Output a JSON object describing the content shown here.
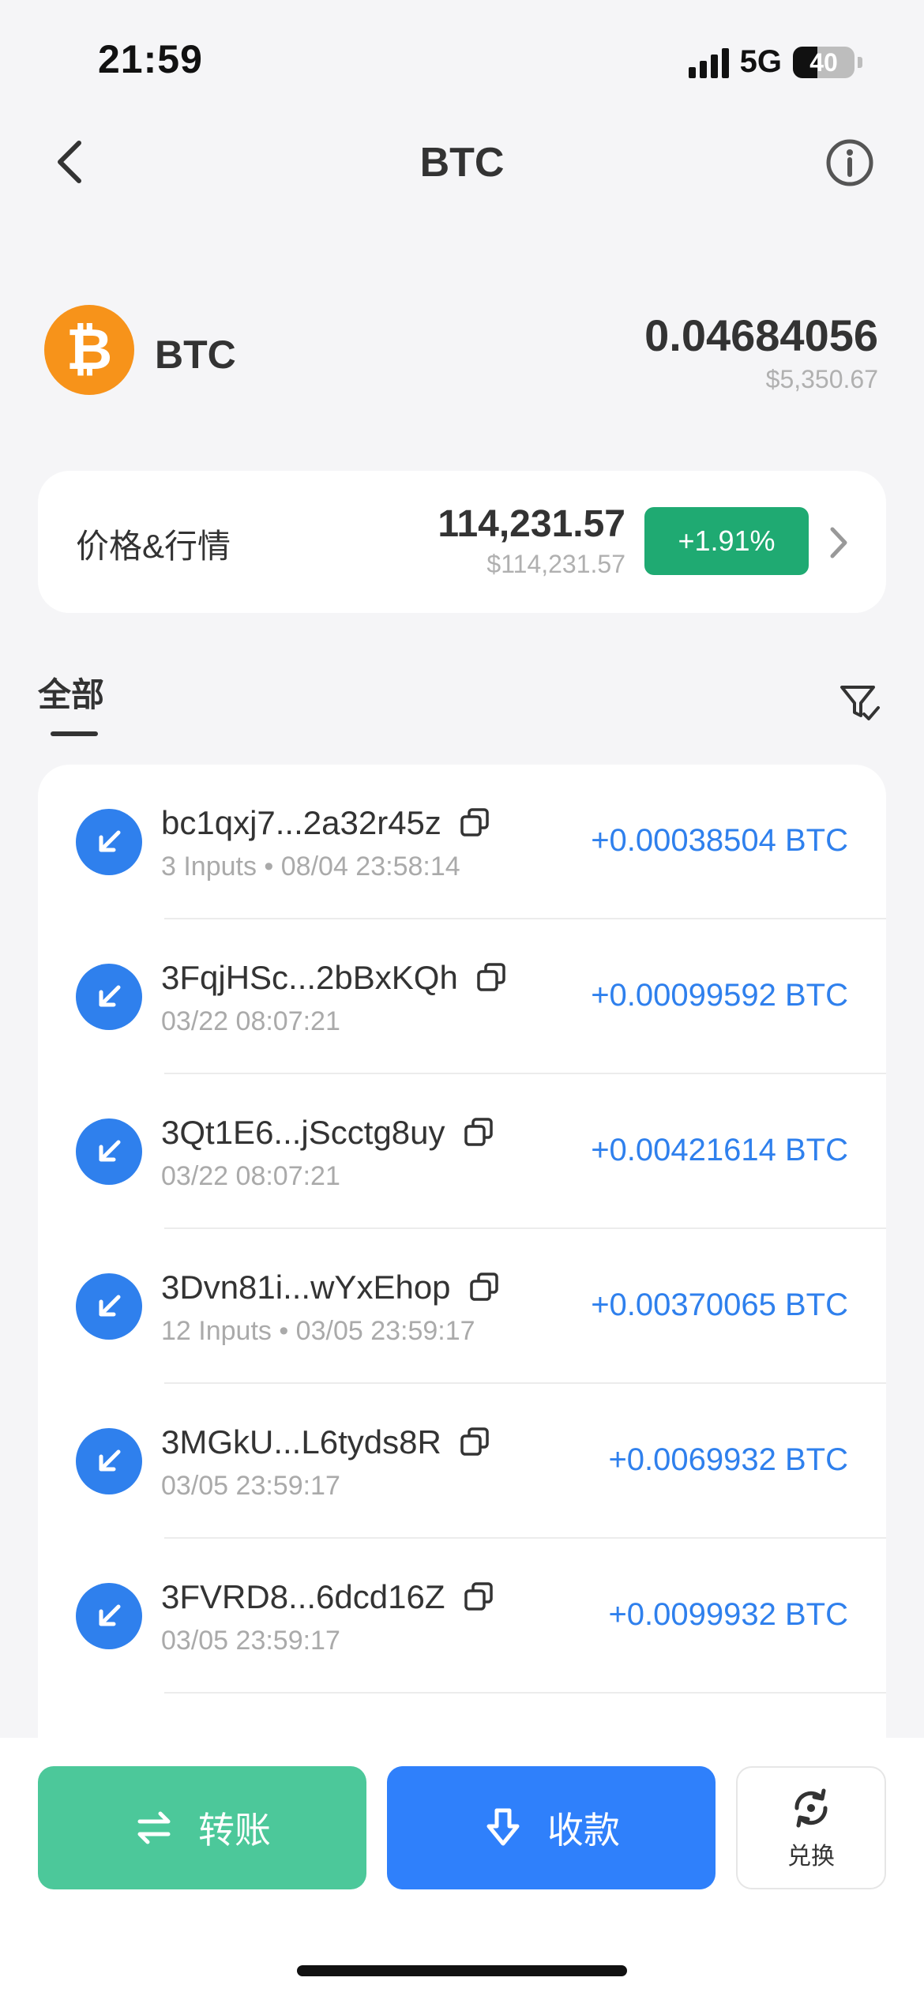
{
  "status_bar": {
    "time": "21:59",
    "network": "5G",
    "battery": "40",
    "battery_level": 0.4
  },
  "nav": {
    "title": "BTC",
    "back_icon": "chevron-left-icon",
    "info_icon": "info-icon"
  },
  "asset": {
    "symbol": "BTC",
    "logo_glyph": "₿",
    "logo_color": "#f7931a",
    "balance": "0.04684056",
    "balance_fiat": "$5,350.67"
  },
  "price_card": {
    "label": "价格&行情",
    "price": "114,231.57",
    "price_fiat": "$114,231.57",
    "change": "+1.91%",
    "change_color": "#1faa72"
  },
  "tabs": {
    "all": "全部",
    "filter_icon": "filter-icon"
  },
  "transactions": [
    {
      "address": "bc1qxj7...2a32r45z",
      "meta": "3 Inputs • 08/04 23:58:14",
      "amount": "+0.00038504 BTC"
    },
    {
      "address": "3FqjHSc...2bBxKQh",
      "meta": "03/22 08:07:21",
      "amount": "+0.00099592 BTC"
    },
    {
      "address": "3Qt1E6...jScctg8uy",
      "meta": "03/22 08:07:21",
      "amount": "+0.00421614 BTC"
    },
    {
      "address": "3Dvn81i...wYxEhop",
      "meta": "12 Inputs • 03/05 23:59:17",
      "amount": "+0.00370065 BTC"
    },
    {
      "address": "3MGkU...L6tyds8R",
      "meta": "03/05 23:59:17",
      "amount": "+0.0069932 BTC"
    },
    {
      "address": "3FVRD8...6dcd16Z",
      "meta": "03/05 23:59:17",
      "amount": "+0.0099932 BTC"
    }
  ],
  "actions": {
    "transfer": "转账",
    "receive": "收款",
    "swap": "兑换",
    "transfer_color": "#4cc89a",
    "receive_color": "#2f80fb"
  }
}
